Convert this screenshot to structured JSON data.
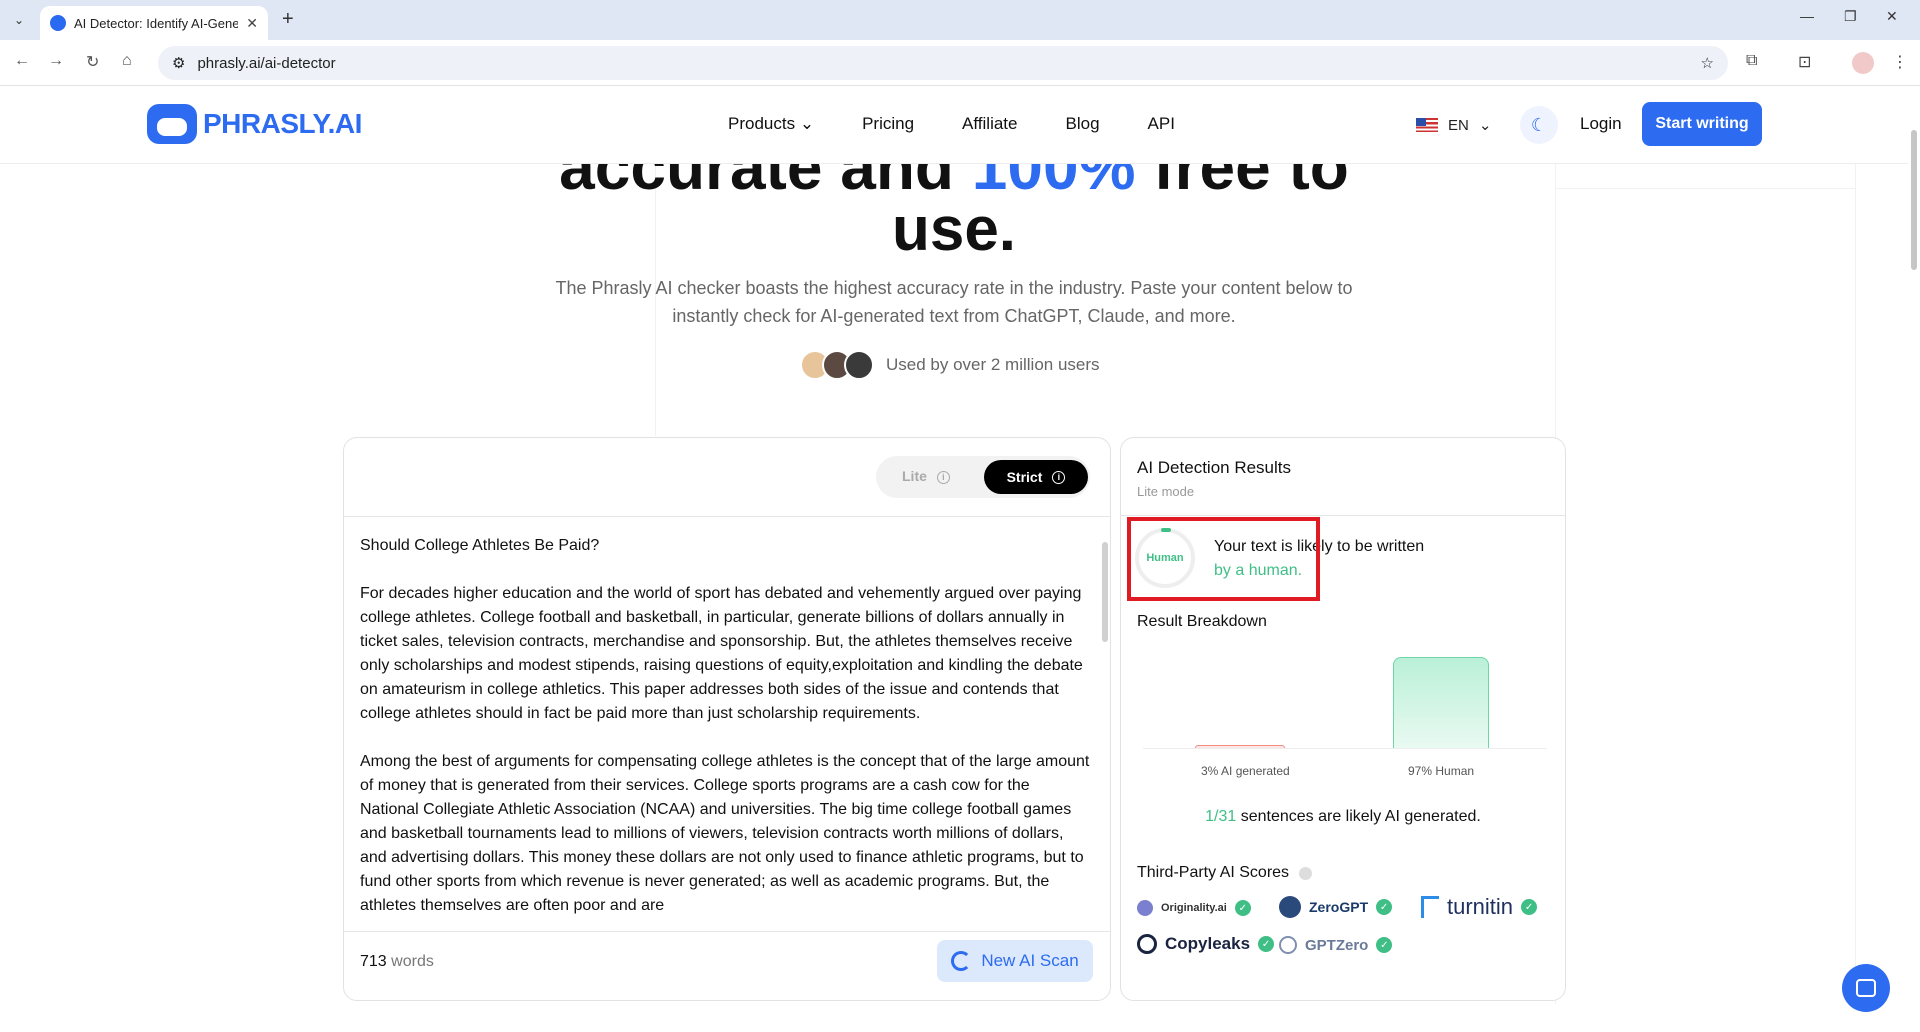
{
  "browser": {
    "tab_title": "AI Detector: Identify AI-Gene",
    "url": "phrasly.ai/ai-detector"
  },
  "header": {
    "logo_text": "PHRASLY.AI",
    "nav": [
      "Products",
      "Pricing",
      "Affiliate",
      "Blog",
      "API"
    ],
    "language": "EN",
    "login_label": "Login",
    "start_label": "Start writing"
  },
  "hero": {
    "line1_a": "accurate and ",
    "line1_blue": "100%",
    "line1_b": " free to",
    "line2": "use.",
    "subtitle": "The Phrasly AI checker boasts the highest accuracy rate in the industry. Paste your content below to instantly check for AI-generated text from ChatGPT, Claude, and more.",
    "users_text": "Used by over 2 million users"
  },
  "editor": {
    "mode_lite": "Lite",
    "mode_strict": "Strict",
    "paragraphs": [
      "Should College Athletes Be Paid?",
      "For decades higher education and the world of sport has debated and vehemently argued over paying college athletes. College football and basketball, in particular, generate billions of dollars annually in ticket sales, television contracts, merchandise and sponsorship. But, the athletes themselves receive only scholarships and modest stipends, raising questions of equity,exploitation and kindling the debate on amateurism in college athletics. This paper addresses both sides of the issue and contends that college athletes should in fact be paid more than just scholarship requirements.",
      "Among the best of arguments for compensating college athletes is the concept that of the large amount of money that is generated from their services. College sports programs are a cash cow for the National Collegiate Athletic Association (NCAA) and universities. The big time college football games and basketball tournaments lead to millions of viewers, television contracts worth millions of dollars, and advertising dollars. This money these dollars are not only used to finance athletic programs, but to fund other sports from which revenue is never generated; as well as academic programs. But, the athletes themselves are often poor and are"
    ],
    "word_count": "713",
    "words_label": "words",
    "scan_label": "New AI Scan"
  },
  "results": {
    "title": "AI Detection Results",
    "mode": "Lite mode",
    "gauge_label": "Human",
    "verdict_line1": "Your text is likely to be written",
    "verdict_line2": "by a human.",
    "breakdown_title": "Result Breakdown",
    "ai_label": "3% AI generated",
    "human_label": "97% Human",
    "ai_percent": 3,
    "human_percent": 97,
    "sentences_count": "1/31",
    "sentences_text_a": " sentences are likely ",
    "sentences_text_b": "AI generated.",
    "third_party_title": "Third-Party AI Scores",
    "third_party": [
      "Originality.ai",
      "ZeroGPT",
      "turnitin",
      "Copyleaks",
      "GPTZero"
    ]
  },
  "colors": {
    "brand_blue": "#2d6cf0",
    "human_green": "#3fbf86",
    "highlight_red": "#e01b24"
  }
}
